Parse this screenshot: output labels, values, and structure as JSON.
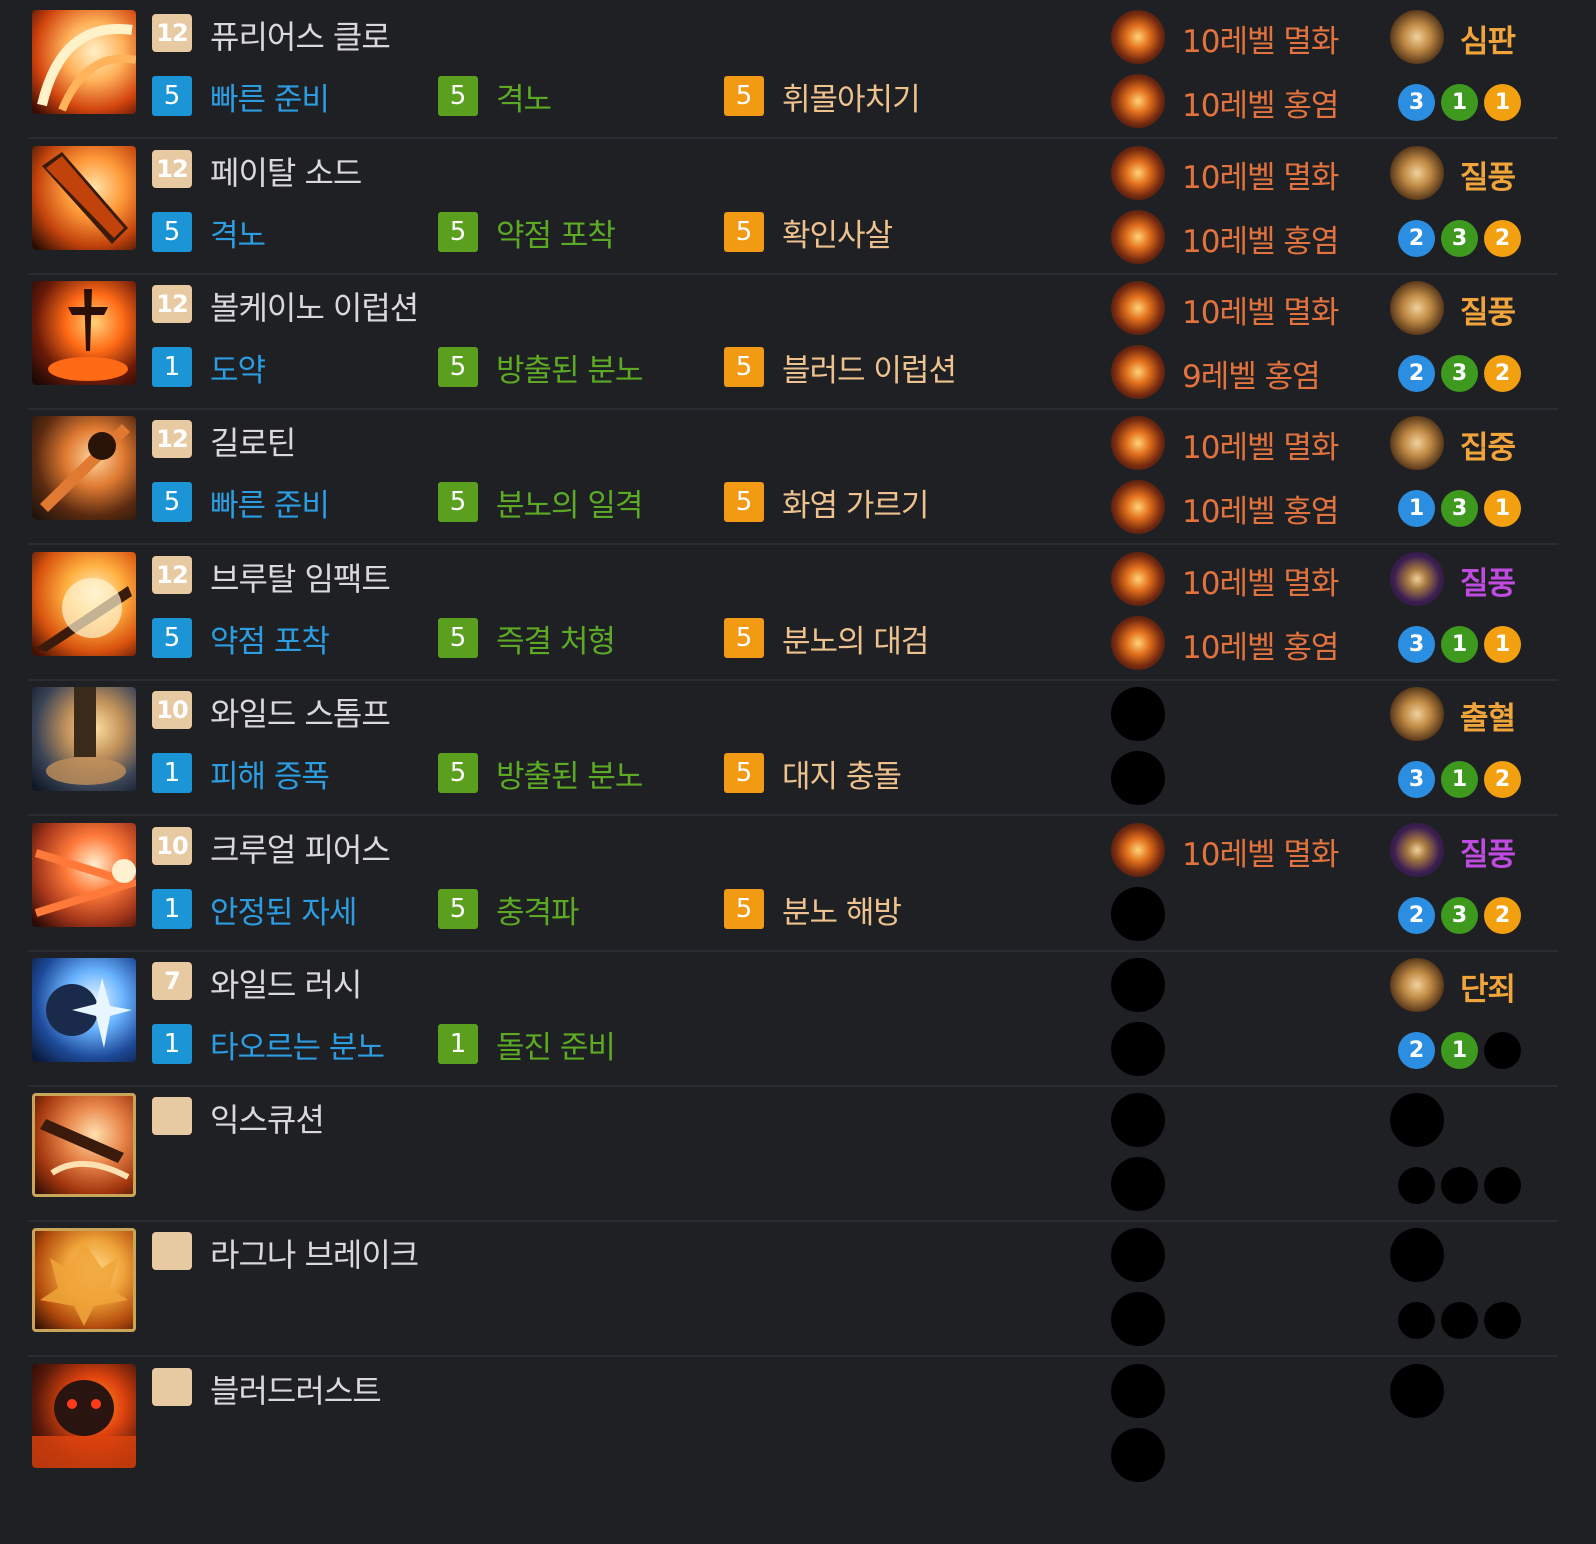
{
  "skills": [
    {
      "level": "12",
      "name": "퓨리어스 클로",
      "tripods": [
        {
          "lv": "5",
          "name": "빠른 준비"
        },
        {
          "lv": "5",
          "name": "격노"
        },
        {
          "lv": "5",
          "name": "휘몰아치기"
        }
      ],
      "gem1": "10레벨 멸화",
      "gem2": "10레벨 홍염",
      "rune": "심판",
      "rune_color": "gold",
      "dots": [
        "3",
        "1",
        "1"
      ]
    },
    {
      "level": "12",
      "name": "페이탈 소드",
      "tripods": [
        {
          "lv": "5",
          "name": "격노"
        },
        {
          "lv": "5",
          "name": "약점 포착"
        },
        {
          "lv": "5",
          "name": "확인사살"
        }
      ],
      "gem1": "10레벨 멸화",
      "gem2": "10레벨 홍염",
      "rune": "질풍",
      "rune_color": "gold",
      "dots": [
        "2",
        "3",
        "2"
      ]
    },
    {
      "level": "12",
      "name": "볼케이노 이럽션",
      "tripods": [
        {
          "lv": "1",
          "name": "도약"
        },
        {
          "lv": "5",
          "name": "방출된 분노"
        },
        {
          "lv": "5",
          "name": "블러드 이럽션"
        }
      ],
      "gem1": "10레벨 멸화",
      "gem2": "9레벨 홍염",
      "rune": "질풍",
      "rune_color": "gold",
      "dots": [
        "2",
        "3",
        "2"
      ]
    },
    {
      "level": "12",
      "name": "길로틴",
      "tripods": [
        {
          "lv": "5",
          "name": "빠른 준비"
        },
        {
          "lv": "5",
          "name": "분노의 일격"
        },
        {
          "lv": "5",
          "name": "화염 가르기"
        }
      ],
      "gem1": "10레벨 멸화",
      "gem2": "10레벨 홍염",
      "rune": "집중",
      "rune_color": "gold",
      "dots": [
        "1",
        "3",
        "1"
      ]
    },
    {
      "level": "12",
      "name": "브루탈 임팩트",
      "tripods": [
        {
          "lv": "5",
          "name": "약점 포착"
        },
        {
          "lv": "5",
          "name": "즉결 처형"
        },
        {
          "lv": "5",
          "name": "분노의 대검"
        }
      ],
      "gem1": "10레벨 멸화",
      "gem2": "10레벨 홍염",
      "rune": "질풍",
      "rune_color": "purple",
      "dots": [
        "3",
        "1",
        "1"
      ]
    },
    {
      "level": "10",
      "name": "와일드 스톰프",
      "tripods": [
        {
          "lv": "1",
          "name": "피해 증폭"
        },
        {
          "lv": "5",
          "name": "방출된 분노"
        },
        {
          "lv": "5",
          "name": "대지 충돌"
        }
      ],
      "gem1": "",
      "gem2": "",
      "rune": "출혈",
      "rune_color": "gold",
      "dots": [
        "3",
        "1",
        "2"
      ]
    },
    {
      "level": "10",
      "name": "크루얼 피어스",
      "tripods": [
        {
          "lv": "1",
          "name": "안정된 자세"
        },
        {
          "lv": "5",
          "name": "충격파"
        },
        {
          "lv": "5",
          "name": "분노 해방"
        }
      ],
      "gem1": "10레벨 멸화",
      "gem2": "",
      "rune": "질풍",
      "rune_color": "purple",
      "dots": [
        "2",
        "3",
        "2"
      ]
    },
    {
      "level": "7",
      "name": "와일드 러시",
      "tripods": [
        {
          "lv": "1",
          "name": "타오르는 분노"
        },
        {
          "lv": "1",
          "name": "돌진 준비"
        }
      ],
      "gem1": "",
      "gem2": "",
      "rune": "단죄",
      "rune_color": "gold",
      "dots": [
        "2",
        "1",
        ""
      ]
    },
    {
      "level": "",
      "name": "익스큐션",
      "tripods": [],
      "gem1": "",
      "gem2": "",
      "rune": "",
      "rune_color": "",
      "dots": [
        "",
        "",
        ""
      ]
    },
    {
      "level": "",
      "name": "라그나 브레이크",
      "tripods": [],
      "gem1": "",
      "gem2": "",
      "rune": "",
      "rune_color": "",
      "dots": [
        "",
        "",
        ""
      ]
    },
    {
      "level": "",
      "name": "블러드러스트",
      "tripods": [],
      "gem1": "",
      "gem2": "",
      "rune": "",
      "rune_color": "",
      "dots": []
    }
  ],
  "icon_names": [
    "furious-claw-icon",
    "fatal-sword-icon",
    "volcano-eruption-icon",
    "guillotine-icon",
    "brutal-impact-icon",
    "wild-stomp-icon",
    "cruel-pierce-icon",
    "wild-rush-icon",
    "execution-icon",
    "ragna-break-icon",
    "bloodlust-icon"
  ],
  "colors": {
    "background": "#1f2024",
    "level_badge": "#e7c9a2",
    "tripod_tier1": "#1b95d6",
    "tripod_tier2": "#5aa01e",
    "tripod_tier3": "#f29a14",
    "gem_text": "#e2733e",
    "rune_gold": "#f0a43a",
    "rune_purple": "#c04be0"
  }
}
